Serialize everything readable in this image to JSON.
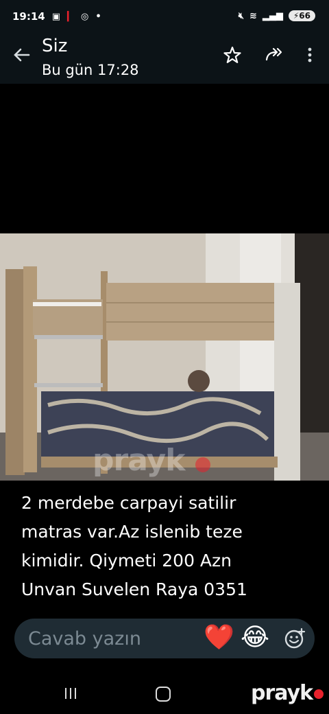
{
  "status_bar": {
    "time": "19:14",
    "battery": "66"
  },
  "header": {
    "title": "Siz",
    "subtitle": "Bu gün 17:28"
  },
  "media": {
    "watermark": "prayk"
  },
  "message": {
    "text": "2 merdebe carpayi satilir\nmatras var.Az islenib  teze\nkimidir. Qiymeti 200 Azn\nUnvan Suvelen Raya 0351"
  },
  "reply": {
    "placeholder": "Cavab yazın",
    "emoji_heart": "❤️",
    "emoji_laugh": "😂"
  },
  "branding": {
    "logo": "prayk"
  },
  "colors": {
    "bar_bg": "#0c1317",
    "input_bg": "#1f2c34",
    "brand_red": "#e8212c"
  }
}
